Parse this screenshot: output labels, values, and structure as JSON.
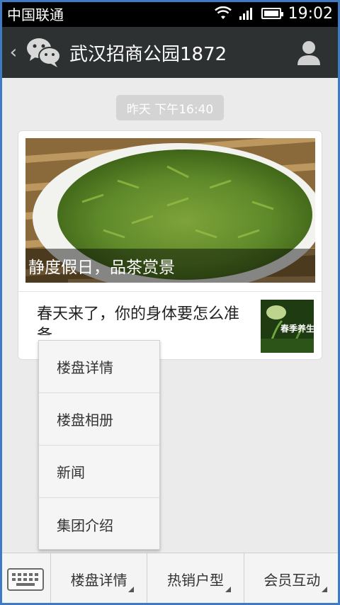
{
  "status_bar": {
    "carrier": "中国联通",
    "time": "19:02"
  },
  "header": {
    "back_icon": "chevron-left-icon",
    "avatar_icon": "wechat-icon",
    "title": "武汉招商公园1872",
    "profile_icon": "person-icon"
  },
  "chat": {
    "timestamp": "昨天 下午16:40",
    "card": {
      "cover_caption": "静度假日，品茶赏景",
      "subtitle": "春天来了，你的身体要怎么准备",
      "thumb_text": "春季养生"
    }
  },
  "popup_menu": {
    "items": [
      {
        "label": "楼盘详情"
      },
      {
        "label": "楼盘相册"
      },
      {
        "label": "新闻"
      },
      {
        "label": "集团介绍"
      }
    ]
  },
  "bottom_menu": {
    "keyboard_icon": "keyboard-icon",
    "tabs": [
      {
        "label": "楼盘详情"
      },
      {
        "label": "热销户型"
      },
      {
        "label": "会员互动"
      }
    ]
  },
  "colors": {
    "title_bar": "#2e3132",
    "status_bar": "#000000",
    "chat_background": "#ebebeb",
    "frame_border": "#3d7bc4"
  }
}
